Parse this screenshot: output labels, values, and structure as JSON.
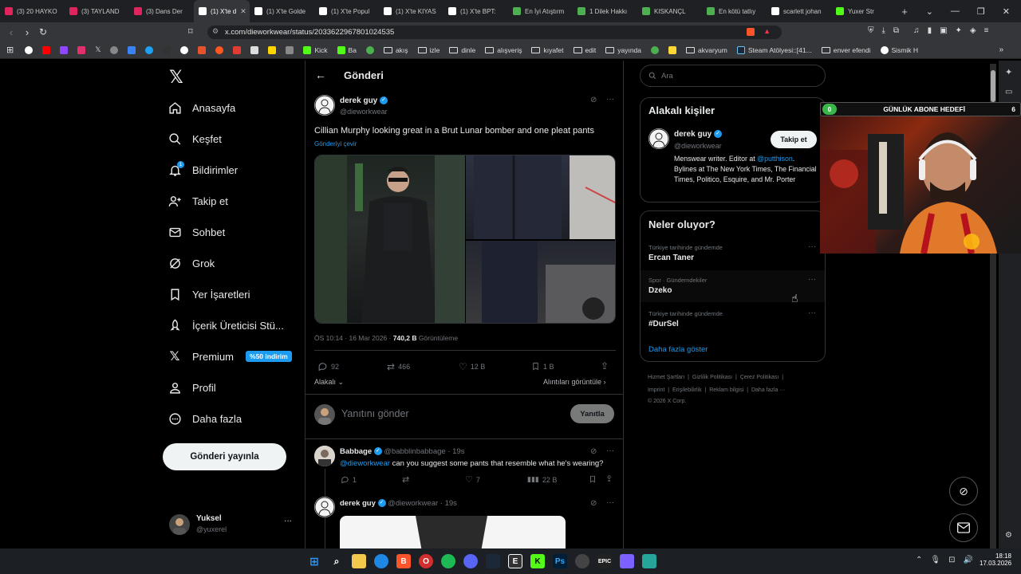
{
  "browser": {
    "tabs": [
      {
        "label": "(3) 20 HAYKO",
        "color": "#e0245e"
      },
      {
        "label": "(3) TAYLAND",
        "color": "#e0245e"
      },
      {
        "label": "(3) Dans Der",
        "color": "#e0245e"
      },
      {
        "label": "(1) X'te d",
        "color": "#ffffff",
        "active": true
      },
      {
        "label": "(1) X'te Golde",
        "color": "#ffffff"
      },
      {
        "label": "(1) X'te Popul",
        "color": "#ffffff"
      },
      {
        "label": "(1) X'te KIYAS",
        "color": "#ffffff"
      },
      {
        "label": "(1) X'te BPT:",
        "color": "#ffffff"
      },
      {
        "label": "En İyi Atıştırm",
        "color": "#4caf50"
      },
      {
        "label": "1 Dilek Hakkı",
        "color": "#4caf50"
      },
      {
        "label": "KISKANÇL",
        "color": "#4caf50"
      },
      {
        "label": "En kötü tatlıy",
        "color": "#4caf50"
      },
      {
        "label": "scarlett johan",
        "color": "#ffffff"
      },
      {
        "label": "Yuxer Str",
        "color": "#53fc18"
      }
    ],
    "new_tab": "+",
    "url": "x.com/dieworkwear/status/2033622967801024535",
    "bookmarks": [
      "Kick",
      "Ba",
      "akış",
      "izle",
      "dinle",
      "alışveriş",
      "kıyafet",
      "edit",
      "yayında",
      "akvaryum",
      "Steam Atölyesi::[41...",
      "enver efendi",
      "Sismik H"
    ]
  },
  "sidebar": {
    "items": [
      {
        "label": "Anasayfa",
        "icon": "home-icon"
      },
      {
        "label": "Keşfet",
        "icon": "search-icon"
      },
      {
        "label": "Bildirimler",
        "icon": "bell-icon"
      },
      {
        "label": "Takip et",
        "icon": "follow-icon"
      },
      {
        "label": "Sohbet",
        "icon": "mail-icon"
      },
      {
        "label": "Grok",
        "icon": "grok-icon"
      },
      {
        "label": "Yer İşaretleri",
        "icon": "bookmark-icon"
      },
      {
        "label": "İçerik Üreticisi Stü...",
        "icon": "rocket-icon"
      },
      {
        "label": "Premium",
        "icon": "x-icon"
      },
      {
        "label": "Profil",
        "icon": "profile-icon"
      },
      {
        "label": "Daha fazla",
        "icon": "more-icon"
      }
    ],
    "notification_count": "1",
    "premium_badge": "%50 indirim",
    "post_button": "Gönderi yayınla",
    "account": {
      "name": "Yuksel",
      "handle": "@yuxerel"
    }
  },
  "main": {
    "header_title": "Gönderi",
    "tweet": {
      "author": "derek guy",
      "handle": "@dieworkwear",
      "text": "Cillian Murphy looking great in a Brut Lunar bomber and one pleat pants",
      "translate": "Gönderiyi çevir",
      "time": "ÖS 10:14 · 16 Mar 2026 · ",
      "views": "740,2 B",
      "views_label": "Görüntüleme",
      "replies": "92",
      "retweets": "466",
      "likes": "12 B",
      "bookmarks": "1 B",
      "sort": "Alakalı",
      "quotes_link": "Alıntıları görüntüle"
    },
    "reply_box": {
      "placeholder": "Yanıtını gönder",
      "button": "Yanıtla"
    },
    "replies": [
      {
        "author": "Babbage",
        "handle": "@babblinbabbage",
        "time": "· 19s",
        "mention": "@dieworkwear",
        "text": " can you suggest some pants that resemble what he's wearing?",
        "stats": {
          "replies": "1",
          "retweets": "",
          "likes": "7",
          "views": "22 B"
        }
      },
      {
        "author": "derek guy",
        "handle": "@dieworkwear",
        "time": "· 19s"
      }
    ]
  },
  "right": {
    "search_placeholder": "Ara",
    "relevant": {
      "title": "Alakalı kişiler",
      "name": "derek guy",
      "handle": "@dieworkwear",
      "follow": "Takip et",
      "bio_a": "Menswear writer. Editor at ",
      "bio_mention": "@putthison",
      "bio_b": ". Bylines at The New York Times, The Financial Times, Politico, Esquire, and Mr. Porter"
    },
    "trends": {
      "title": "Neler oluyor?",
      "items": [
        {
          "meta": "Türkiye tarihinde gündemde",
          "name": "Ercan Taner"
        },
        {
          "meta": "Spor · Gündemdekiler",
          "name": "Dzeko"
        },
        {
          "meta": "Türkiye tarihinde gündemde",
          "name": "#DurSel"
        }
      ],
      "show_more": "Daha fazla göster"
    },
    "footer": {
      "line1": [
        "Hizmet Şartları",
        "Gizlilik Politikası",
        "Çerez Politikası"
      ],
      "line2": [
        "Imprint",
        "Erişilebilirlik",
        "Reklam bilgisi",
        "Daha fazla ···"
      ],
      "copyright": "© 2026 X Corp."
    }
  },
  "overlay": {
    "goal_left": "0",
    "goal_title": "GÜNLÜK ABONE HEDEFİ",
    "goal_right": "6"
  },
  "taskbar": {
    "time": "18:18",
    "date": "17.03.2026"
  },
  "colors": {
    "accent": "#1d9bf0",
    "background": "#000000",
    "border": "#2f3336"
  }
}
